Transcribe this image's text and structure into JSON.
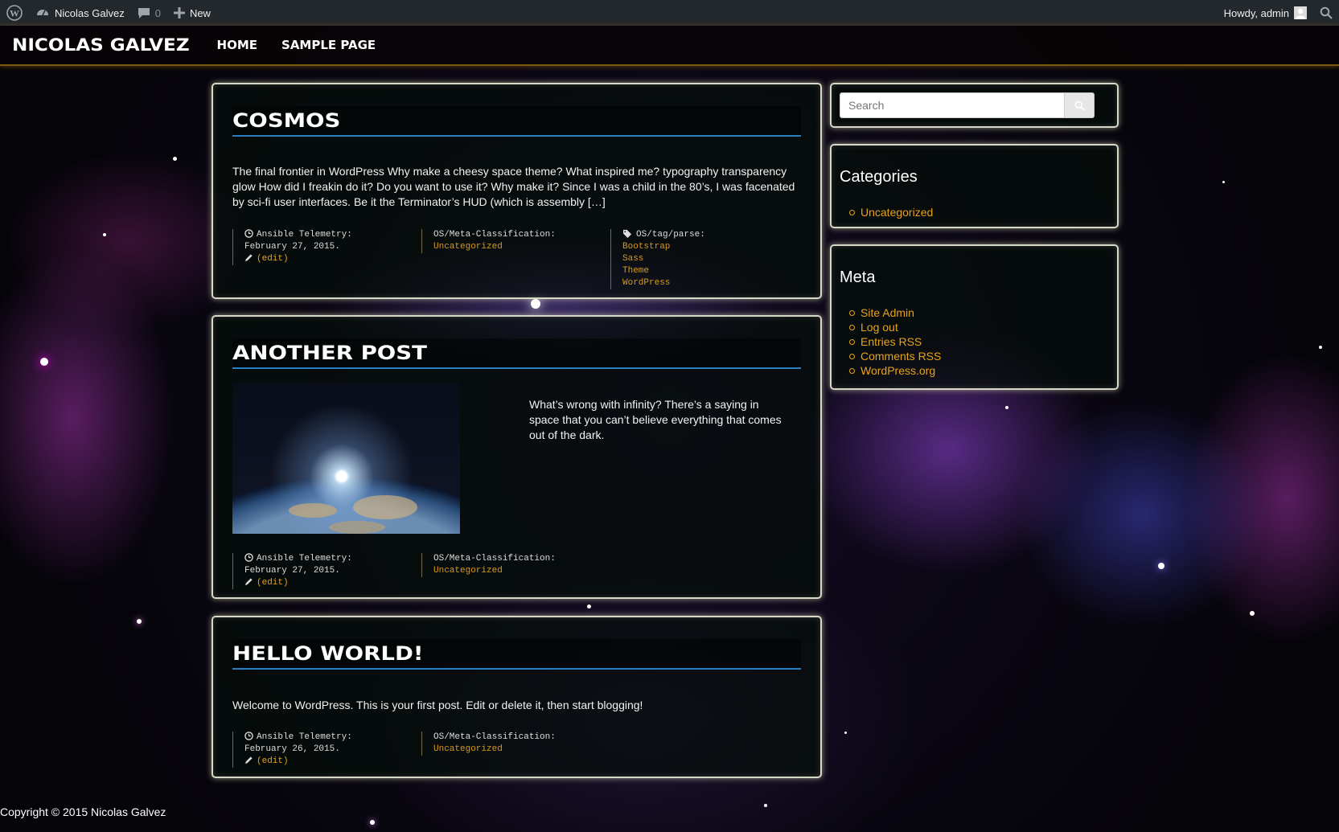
{
  "adminbar": {
    "site_name": "Nicolas Galvez",
    "comments_count": "0",
    "new_label": "New",
    "howdy": "Howdy, admin"
  },
  "site": {
    "title": "NICOLAS GALVEZ",
    "nav": [
      "HOME",
      "SAMPLE PAGE"
    ]
  },
  "posts": [
    {
      "title": "COSMOS",
      "excerpt": "The final frontier in WordPress Why make a cheesy space theme? What inspired me? typography transparency glow How did I freakin do it? Do you want to use it? Why make it? Since I was a child in the 80’s, I was facenated by sci-fi user interfaces. Be it the Terminator’s HUD (which is assembly […]",
      "telemetry_label": "Ansible Telemetry:",
      "date": "February 27, 2015.",
      "edit": "(edit)",
      "classification_label": "OS/Meta-Classification:",
      "category": "Uncategorized",
      "tags_label": "OS/tag/parse:",
      "tags": [
        "Bootstrap",
        "Sass",
        "Theme",
        "WordPress"
      ]
    },
    {
      "title": "ANOTHER POST",
      "excerpt": "What’s wrong with infinity? There’s a saying in space that you can’t believe everything that comes out of the dark.",
      "telemetry_label": "Ansible Telemetry:",
      "date": "February 27, 2015.",
      "edit": "(edit)",
      "classification_label": "OS/Meta-Classification:",
      "category": "Uncategorized"
    },
    {
      "title": "HELLO WORLD!",
      "excerpt": "Welcome to WordPress. This is your first post. Edit or delete it, then start blogging!",
      "telemetry_label": "Ansible Telemetry:",
      "date": "February 26, 2015.",
      "edit": "(edit)",
      "classification_label": "OS/Meta-Classification:",
      "category": "Uncategorized"
    }
  ],
  "sidebar": {
    "search_placeholder": "Search",
    "categories_title": "Categories",
    "categories": [
      "Uncategorized"
    ],
    "meta_title": "Meta",
    "meta_links": [
      "Site Admin",
      "Log out",
      "Entries RSS",
      "Comments RSS",
      "WordPress.org"
    ]
  },
  "footer": {
    "copyright": "Copyright © 2015 Nicolas Galvez"
  },
  "colors": {
    "link": "#e8a317",
    "title_underline": "#2a7fc0",
    "adminbar": "#23282d"
  }
}
